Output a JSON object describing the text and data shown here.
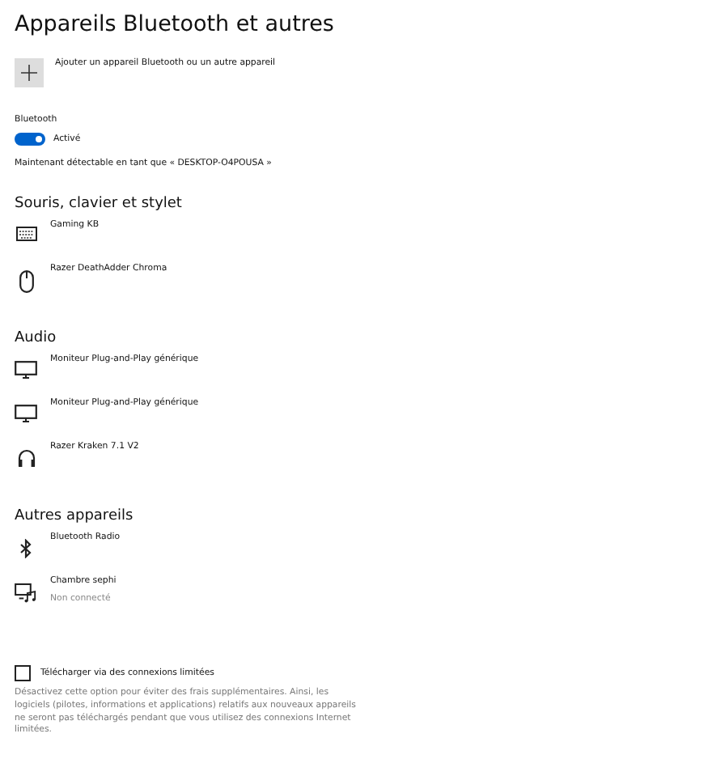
{
  "title": "Appareils Bluetooth et autres",
  "add_device": {
    "label": "Ajouter un appareil Bluetooth ou un autre appareil"
  },
  "bluetooth": {
    "label": "Bluetooth",
    "on": true,
    "state_label": "Activé",
    "discoverable": "Maintenant détectable en tant que « DESKTOP-O4POUSA »"
  },
  "sections": [
    {
      "heading": "Souris, clavier et stylet",
      "devices": [
        {
          "kind": "keyboard",
          "name": "Gaming KB"
        },
        {
          "kind": "mouse",
          "name": "Razer DeathAdder Chroma"
        }
      ]
    },
    {
      "heading": "Audio",
      "devices": [
        {
          "kind": "monitor",
          "name": "Moniteur Plug-and-Play générique"
        },
        {
          "kind": "monitor",
          "name": "Moniteur Plug-and-Play générique"
        },
        {
          "kind": "headphones",
          "name": "Razer Kraken 7.1 V2"
        }
      ]
    },
    {
      "heading": "Autres appareils",
      "devices": [
        {
          "kind": "bluetooth",
          "name": "Bluetooth Radio"
        },
        {
          "kind": "media",
          "name": "Chambre sephi",
          "status": "Non connecté"
        }
      ]
    }
  ],
  "metered": {
    "label": "Télécharger via des connexions limitées",
    "checked": false,
    "description": "Désactivez cette option pour éviter des frais supplémentaires. Ainsi, les logiciels (pilotes, informations et applications) relatifs aux nouveaux appareils ne seront pas téléchargés pendant que vous utilisez des connexions Internet limitées."
  }
}
